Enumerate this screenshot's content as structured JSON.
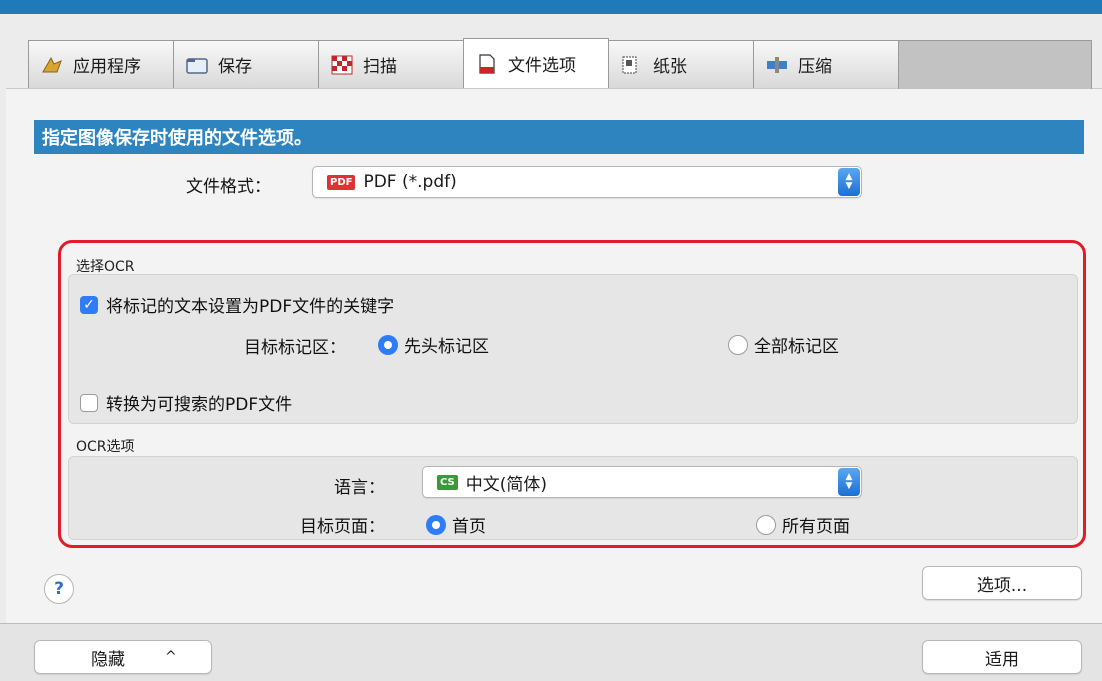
{
  "tabs": [
    {
      "label": "应用程序",
      "icon": "applications-icon",
      "active": false
    },
    {
      "label": "保存",
      "icon": "folder-icon",
      "active": false
    },
    {
      "label": "扫描",
      "icon": "scan-icon",
      "active": false
    },
    {
      "label": "文件选项",
      "icon": "file-icon",
      "active": true
    },
    {
      "label": "纸张",
      "icon": "paper-icon",
      "active": false
    },
    {
      "label": "压缩",
      "icon": "compress-icon",
      "active": false
    }
  ],
  "header": {
    "text": "指定图像保存时使用的文件选项。"
  },
  "file_format": {
    "label": "文件格式：",
    "badge": "PDF",
    "value": "PDF (*.pdf)"
  },
  "select_ocr": {
    "title": "选择OCR",
    "keyword_checkbox": {
      "label": "将标记的文本设置为PDF文件的关键字",
      "checked": true
    },
    "target_area": {
      "label": "目标标记区：",
      "options": [
        {
          "label": "先头标记区",
          "selected": true
        },
        {
          "label": "全部标记区",
          "selected": false
        }
      ]
    },
    "searchable_checkbox": {
      "label": "转换为可搜索的PDF文件",
      "checked": false
    }
  },
  "ocr_options": {
    "title": "OCR选项",
    "language": {
      "label": "语言：",
      "badge": "CS",
      "value": "中文(简体)"
    },
    "target_page": {
      "label": "目标页面：",
      "options": [
        {
          "label": "首页",
          "selected": true
        },
        {
          "label": "所有页面",
          "selected": false
        }
      ]
    }
  },
  "help": {
    "label": "?"
  },
  "options_button": {
    "label": "选项..."
  },
  "hide_button": {
    "label": "隐藏",
    "chevron": "^"
  },
  "apply_button": {
    "label": "适用"
  },
  "colors": {
    "accent": "#2d84be",
    "highlight": "#e21a2a",
    "control_blue": "#2e7cf6"
  }
}
